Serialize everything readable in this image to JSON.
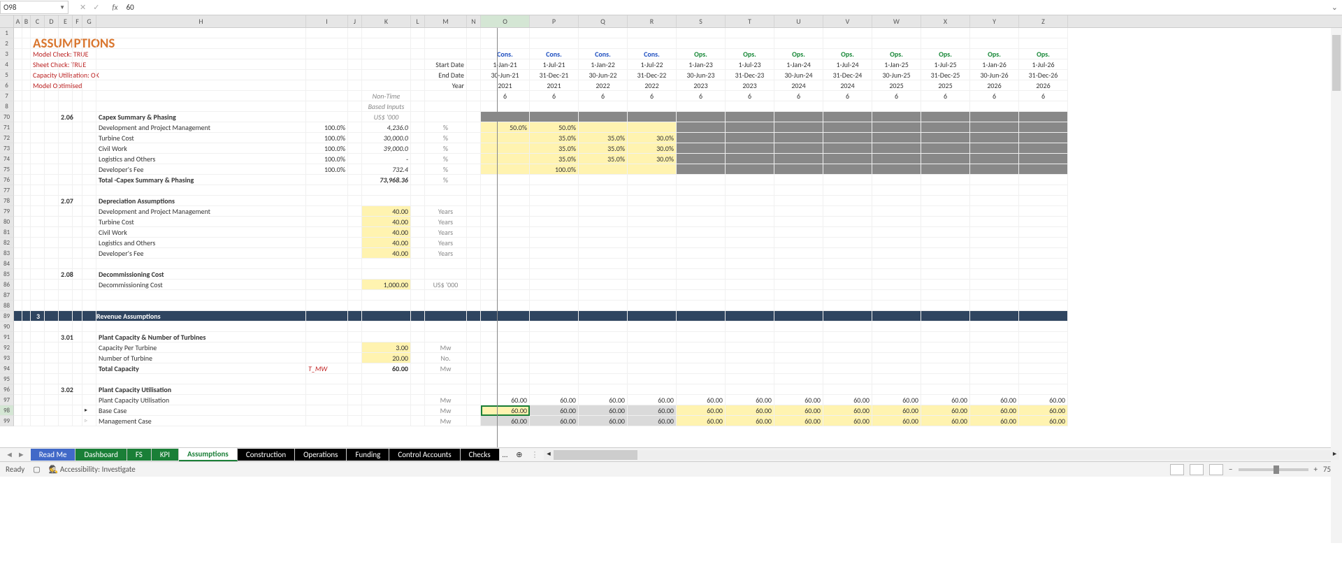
{
  "nameBox": "O98",
  "formulaValue": "60",
  "columns": [
    "A",
    "B",
    "C",
    "D",
    "E",
    "F",
    "G",
    "H",
    "I",
    "J",
    "K",
    "L",
    "M",
    "N",
    "O",
    "P",
    "Q",
    "R",
    "S",
    "T",
    "U",
    "V",
    "W",
    "X",
    "Y",
    "Z"
  ],
  "title": "ASSUMPTIONS",
  "checks": {
    "model": "Model Check: TRUE",
    "sheet": "Sheet Check: TRUE",
    "capacity": "Capacity Utilisation: OK",
    "optimised": "Model Optimised"
  },
  "dateLabels": {
    "start": "Start Date",
    "end": "End Date",
    "year": "Year"
  },
  "periods": [
    {
      "phase": "Cons.",
      "start": "1-Jan-21",
      "end": "30-Jun-21",
      "year": "2021",
      "n": "6"
    },
    {
      "phase": "Cons.",
      "start": "1-Jul-21",
      "end": "31-Dec-21",
      "year": "2021",
      "n": "6"
    },
    {
      "phase": "Cons.",
      "start": "1-Jan-22",
      "end": "30-Jun-22",
      "year": "2022",
      "n": "6"
    },
    {
      "phase": "Cons.",
      "start": "1-Jul-22",
      "end": "31-Dec-22",
      "year": "2022",
      "n": "6"
    },
    {
      "phase": "Ops.",
      "start": "1-Jan-23",
      "end": "30-Jun-23",
      "year": "2023",
      "n": "6"
    },
    {
      "phase": "Ops.",
      "start": "1-Jul-23",
      "end": "31-Dec-23",
      "year": "2023",
      "n": "6"
    },
    {
      "phase": "Ops.",
      "start": "1-Jan-24",
      "end": "30-Jun-24",
      "year": "2024",
      "n": "6"
    },
    {
      "phase": "Ops.",
      "start": "1-Jul-24",
      "end": "31-Dec-24",
      "year": "2024",
      "n": "6"
    },
    {
      "phase": "Ops.",
      "start": "1-Jan-25",
      "end": "30-Jun-25",
      "year": "2025",
      "n": "6"
    },
    {
      "phase": "Ops.",
      "start": "1-Jul-25",
      "end": "31-Dec-25",
      "year": "2025",
      "n": "6"
    },
    {
      "phase": "Ops.",
      "start": "1-Jan-26",
      "end": "30-Jun-26",
      "year": "2026",
      "n": "6"
    },
    {
      "phase": "Ops.",
      "start": "1-Jul-26",
      "end": "31-Dec-26",
      "year": "2026",
      "n": "6"
    }
  ],
  "nonTime1": "Non-Time",
  "nonTime2": "Based Inputs",
  "uss": "US$ '000",
  "sec206": {
    "num": "2.06",
    "title": "Capex Summary & Phasing"
  },
  "capex": [
    {
      "label": "Development and Project Management",
      "pct": "100.0%",
      "val": "4,236.0",
      "unit": "%",
      "phasing": [
        "50.0%",
        "50.0%",
        "",
        "",
        "",
        "",
        "",
        "",
        "",
        "",
        "",
        ""
      ]
    },
    {
      "label": "Turbine Cost",
      "pct": "100.0%",
      "val": "30,000.0",
      "unit": "%",
      "phasing": [
        "",
        "35.0%",
        "35.0%",
        "30.0%",
        "",
        "",
        "",
        "",
        "",
        "",
        "",
        ""
      ]
    },
    {
      "label": "Civil Work",
      "pct": "100.0%",
      "val": "39,000.0",
      "unit": "%",
      "phasing": [
        "",
        "35.0%",
        "35.0%",
        "30.0%",
        "",
        "",
        "",
        "",
        "",
        "",
        "",
        ""
      ]
    },
    {
      "label": "Logistics and Others",
      "pct": "100.0%",
      "val": "-",
      "unit": "%",
      "phasing": [
        "",
        "35.0%",
        "35.0%",
        "30.0%",
        "",
        "",
        "",
        "",
        "",
        "",
        "",
        ""
      ]
    },
    {
      "label": "Developer's Fee",
      "pct": "100.0%",
      "val": "732.4",
      "unit": "%",
      "phasing": [
        "",
        "100.0%",
        "",
        "",
        "",
        "",
        "",
        "",
        "",
        "",
        "",
        ""
      ]
    }
  ],
  "capexTotal": {
    "label": "Total -Capex Summary & Phasing",
    "val": "73,968.36",
    "unit": "%"
  },
  "sec207": {
    "num": "2.07",
    "title": "Depreciation Assumptions"
  },
  "dep": [
    {
      "label": "Development and Project Management",
      "val": "40.00",
      "unit": "Years"
    },
    {
      "label": "Turbine Cost",
      "val": "40.00",
      "unit": "Years"
    },
    {
      "label": "Civil Work",
      "val": "40.00",
      "unit": "Years"
    },
    {
      "label": "Logistics and Others",
      "val": "40.00",
      "unit": "Years"
    },
    {
      "label": "Developer's Fee",
      "val": "40.00",
      "unit": "Years"
    }
  ],
  "sec208": {
    "num": "2.08",
    "title": "Decommissioning Cost",
    "item": "Decommissioning Cost",
    "val": "1,000.00",
    "unit": "US$ '000"
  },
  "sec3": {
    "num": "3",
    "title": "Revenue Assumptions"
  },
  "sec301": {
    "num": "3.01",
    "title": "Plant Capacity & Number of Turbines"
  },
  "cap": {
    "perTurbine": {
      "label": "Capacity Per Turbine",
      "val": "3.00",
      "unit": "Mw"
    },
    "num": {
      "label": "Number of Turbine",
      "val": "20.00",
      "unit": "No."
    },
    "total": {
      "label": "Total Capacity",
      "tag": "T_MW",
      "val": "60.00",
      "unit": "Mw"
    }
  },
  "sec302": {
    "num": "3.02",
    "title": "Plant Capacity Utilisation"
  },
  "util": {
    "header": {
      "label": "Plant Capacity Utilisation",
      "unit": "Mw",
      "vals": [
        "60.00",
        "60.00",
        "60.00",
        "60.00",
        "60.00",
        "60.00",
        "60.00",
        "60.00",
        "60.00",
        "60.00",
        "60.00",
        "60.00"
      ]
    },
    "base": {
      "label": "Base Case",
      "unit": "Mw",
      "vals": [
        "60.00",
        "60.00",
        "60.00",
        "60.00",
        "60.00",
        "60.00",
        "60.00",
        "60.00",
        "60.00",
        "60.00",
        "60.00",
        "60.00"
      ]
    },
    "mgmt": {
      "label": "Management Case",
      "unit": "Mw",
      "vals": [
        "60.00",
        "60.00",
        "60.00",
        "60.00",
        "60.00",
        "60.00",
        "60.00",
        "60.00",
        "60.00",
        "60.00",
        "60.00",
        "60.00"
      ]
    }
  },
  "rowNums": [
    "1",
    "2",
    "3",
    "4",
    "5",
    "6",
    "7",
    "8",
    "70",
    "71",
    "72",
    "73",
    "74",
    "75",
    "76",
    "77",
    "78",
    "79",
    "80",
    "81",
    "82",
    "83",
    "84",
    "85",
    "86",
    "87",
    "88",
    "89",
    "90",
    "91",
    "92",
    "93",
    "94",
    "95",
    "96",
    "97",
    "98",
    "99"
  ],
  "tabs": [
    "Read Me",
    "Dashboard",
    "FS",
    "KPI",
    "Assumptions",
    "Construction",
    "Operations",
    "Funding",
    "Control Accounts",
    "Checks"
  ],
  "status": {
    "ready": "Ready",
    "access": "Accessibility: Investigate",
    "zoom": "75%"
  }
}
